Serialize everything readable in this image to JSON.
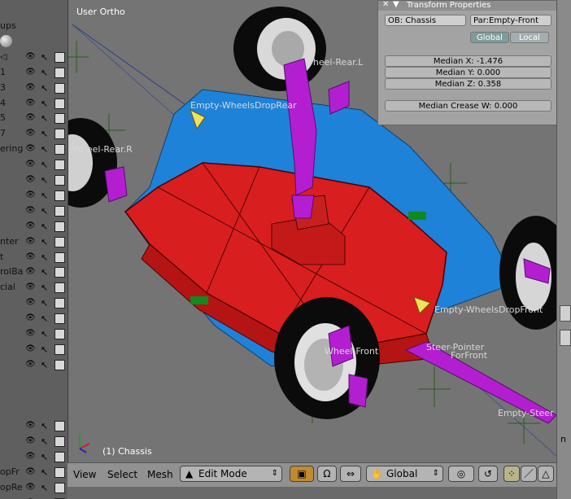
{
  "outliner": {
    "rows": [
      {
        "label": "ups",
        "eye": false
      },
      {
        "label": "",
        "eye": false,
        "ball": true
      },
      {
        "label": "◁",
        "eye": true
      },
      {
        "label": "1",
        "eye": true
      },
      {
        "label": "3",
        "eye": true
      },
      {
        "label": "4",
        "eye": true
      },
      {
        "label": "5",
        "eye": true
      },
      {
        "label": "7",
        "eye": true
      },
      {
        "label": "ering",
        "eye": true
      },
      {
        "label": "",
        "eye": true
      },
      {
        "label": "",
        "eye": true
      },
      {
        "label": "",
        "eye": true
      },
      {
        "label": "",
        "eye": true
      },
      {
        "label": "",
        "eye": true
      },
      {
        "label": "nter",
        "eye": true
      },
      {
        "label": "t",
        "eye": true
      },
      {
        "label": "rolBa",
        "eye": true
      },
      {
        "label": "cial",
        "eye": true
      },
      {
        "label": "",
        "eye": true
      },
      {
        "label": "",
        "eye": true
      },
      {
        "label": "",
        "eye": true
      },
      {
        "label": "",
        "eye": true
      },
      {
        "label": "",
        "eye": true
      },
      {
        "label": "",
        "eye": false
      },
      {
        "label": "",
        "eye": false
      },
      {
        "label": "",
        "eye": false
      },
      {
        "label": "",
        "eye": true
      },
      {
        "label": "",
        "eye": true
      },
      {
        "label": "",
        "eye": true
      },
      {
        "label": "opFr",
        "eye": true
      },
      {
        "label": "opRe",
        "eye": true
      },
      {
        "label": "",
        "eye": true
      }
    ]
  },
  "viewport": {
    "title": "User Ortho",
    "object_label": "(1) Chassis",
    "labels": {
      "wheel_rear_l": "Wheel-Rear.L",
      "wheel_rear_r": "Wheel-Rear.R",
      "empty_wheels_drop_rear": "Empty-WheelsDropRear",
      "empty_wheels_drop_front": "Empty-WheelsDropFront",
      "wheel_front": "Wheel-Front",
      "steer_pointer": "Steer-Pointer",
      "for_front": "ForFront",
      "empty_steer": "Empty-Steer"
    }
  },
  "transform": {
    "title": "Transform Properties",
    "ob_label": "OB: Chassis",
    "par_label": "Par:Empty-Front",
    "global_label": "Global",
    "local_label": "Local",
    "median_x": "Median X: -1.476",
    "median_y": "Median Y: 0.000",
    "median_z": "Median Z: 0.358",
    "median_crease": "Median Crease W: 0.000"
  },
  "header": {
    "view": "View",
    "select": "Select",
    "mesh": "Mesh",
    "mode": "Edit Mode",
    "orientation": "Global"
  },
  "colors": {
    "chassis_red": "#d81e1e",
    "floor_blue": "#1e82d8",
    "bone_magenta": "#b31fd0",
    "outliner_bg": "#5f5f5f",
    "header_bg": "#919191",
    "viewport_bg": "#747474"
  }
}
